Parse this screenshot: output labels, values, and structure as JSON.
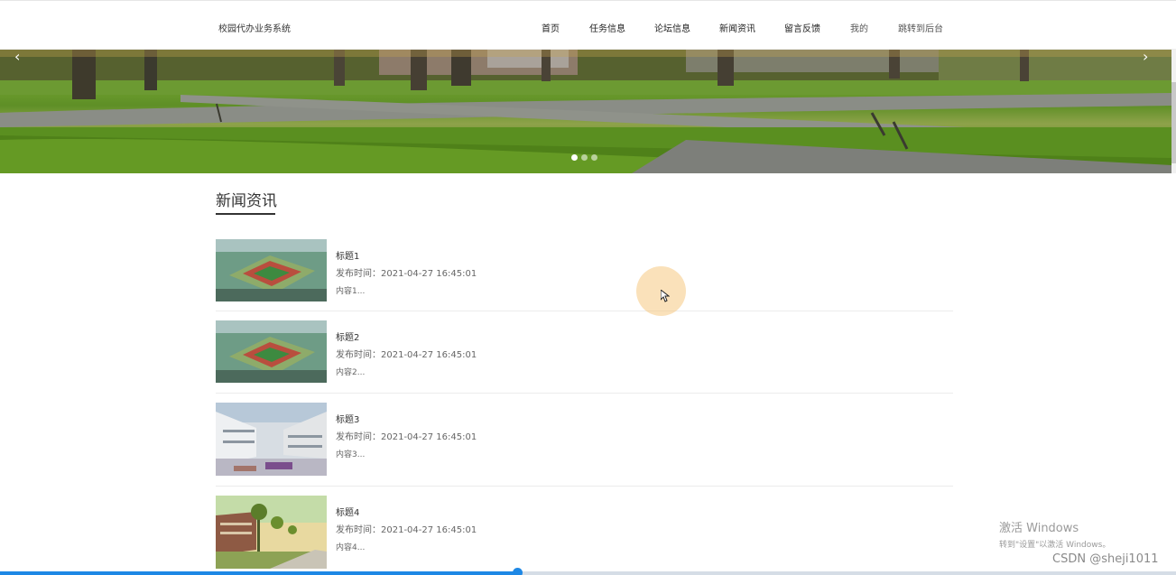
{
  "header": {
    "site_title": "校园代办业务系统",
    "nav": [
      {
        "label": "首页"
      },
      {
        "label": "任务信息"
      },
      {
        "label": "论坛信息"
      },
      {
        "label": "新闻资讯"
      },
      {
        "label": "留言反馈"
      },
      {
        "label": "我的"
      },
      {
        "label": "跳转到后台"
      }
    ]
  },
  "banner": {
    "prev_glyph": "‹",
    "next_glyph": "›",
    "slide_count": 3,
    "active_slide": 1
  },
  "news": {
    "section_title": "新闻资讯",
    "items": [
      {
        "title": "标题1",
        "time": "发布时间：2021-04-27 16:45:01",
        "content": "内容1..."
      },
      {
        "title": "标题2",
        "time": "发布时间：2021-04-27 16:45:01",
        "content": "内容2..."
      },
      {
        "title": "标题3",
        "time": "发布时间：2021-04-27 16:45:01",
        "content": "内容3..."
      },
      {
        "title": "标题4",
        "time": "发布时间：2021-04-27 16:45:01",
        "content": "内容4..."
      }
    ]
  },
  "overlay": {
    "windows_activate_title": "激活 Windows",
    "windows_activate_sub": "转到\"设置\"以激活 Windows。",
    "watermark": "CSDN @sheji1011"
  },
  "video_progress": 0.44
}
